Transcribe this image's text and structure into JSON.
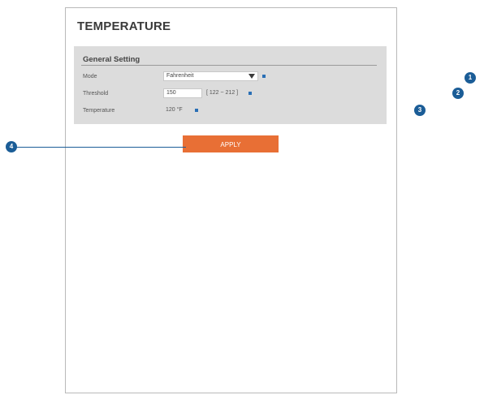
{
  "page": {
    "title": "TEMPERATURE"
  },
  "general_setting": {
    "title": "General Setting",
    "mode": {
      "label": "Mode",
      "value": "Fahrenheit"
    },
    "threshold": {
      "label": "Threshold",
      "value": "150",
      "range": "[ 122 ~ 212 ]"
    },
    "temperature": {
      "label": "Temperature",
      "value": "120 °F"
    }
  },
  "buttons": {
    "apply_label": "APPLY"
  },
  "callouts": [
    "1",
    "2",
    "3",
    "4"
  ],
  "colors": {
    "accent": "#e86f35",
    "callout": "#1b5d97",
    "panel": "#dcdcdc"
  }
}
